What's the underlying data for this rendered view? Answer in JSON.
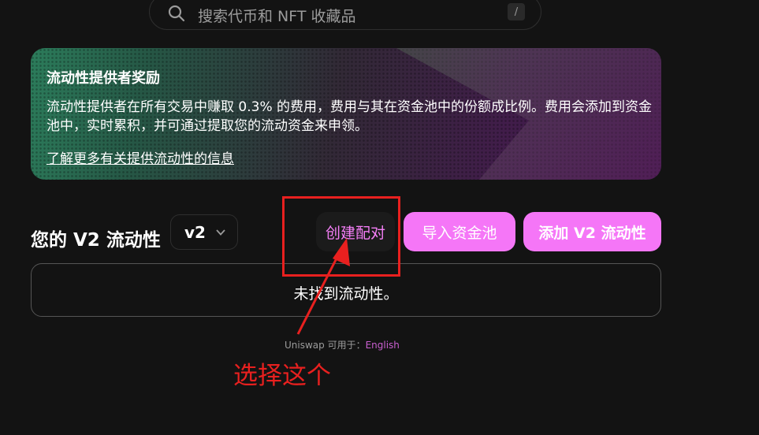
{
  "search": {
    "placeholder": "搜索代币和 NFT 收藏品",
    "shortcut": "/"
  },
  "banner": {
    "title": "流动性提供者奖励",
    "description": "流动性提供者在所有交易中赚取 0.3% 的费用，费用与其在资金池中的份额成比例。费用会添加到资金池中，实时累积，并可通过提取您的流动资金来申领。",
    "link": "了解更多有关提供流动性的信息"
  },
  "liquidity": {
    "title": "您的 V2 流动性",
    "version": "v2",
    "create_pair": "创建配对",
    "import_pool": "导入资金池",
    "add_v2": "添加 V2 流动性",
    "empty": "未找到流动性。"
  },
  "footer": {
    "prefix": "Uniswap 可用于：",
    "language": "English"
  },
  "annotation": {
    "text": "选择这个"
  },
  "colors": {
    "accent": "#f576f7",
    "annotation": "#e8201f",
    "background": "#131313"
  }
}
